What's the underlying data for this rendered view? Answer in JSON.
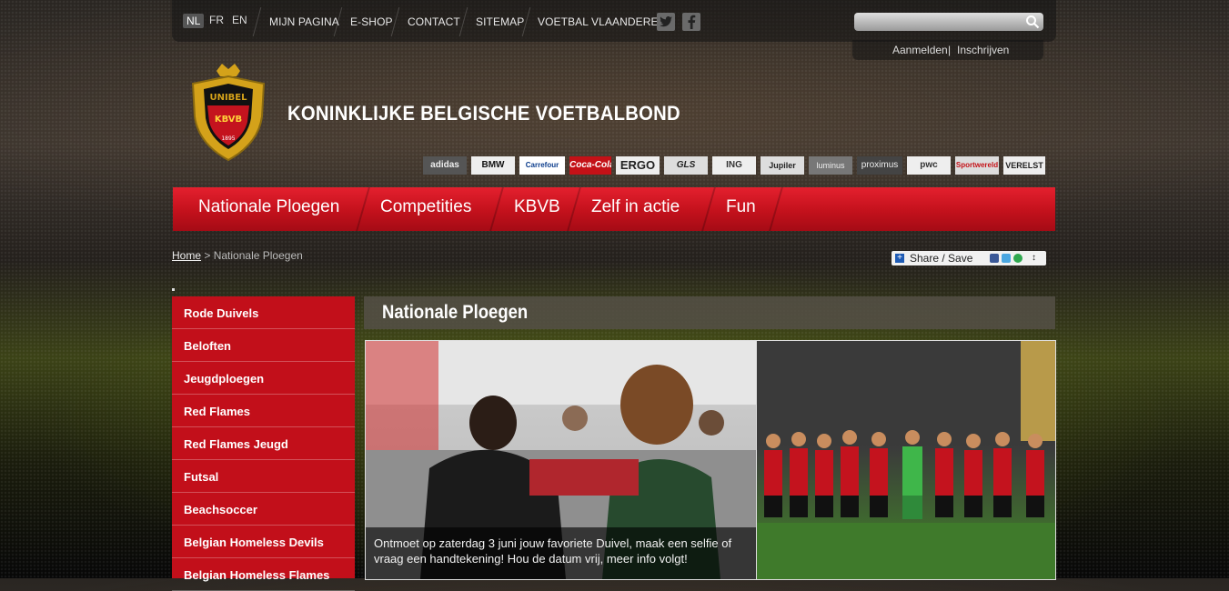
{
  "topbar": {
    "languages": [
      "NL",
      "FR",
      "EN"
    ],
    "links": [
      "MIJN PAGINA",
      "E-SHOP",
      "CONTACT",
      "SITEMAP",
      "VOETBAL VLAANDEREN"
    ],
    "social": [
      "twitter-icon",
      "facebook-icon"
    ],
    "search": {
      "placeholder": ""
    },
    "login": "Aanmelden",
    "login_sep": "|",
    "register": "Inschrijven"
  },
  "header": {
    "title": "KONINKLIJKE BELGISCHE VOETBALBOND",
    "crest_text": [
      "UNIBEL",
      "KBVB",
      "1895"
    ]
  },
  "sponsors": [
    "adidas",
    "BMW",
    "Carrefour",
    "Coca-Cola",
    "ERGO",
    "GLS",
    "ING",
    "Jupiler",
    "luminus",
    "proximus",
    "pwc",
    "Sportwereld",
    "VERELST"
  ],
  "nav": [
    "Nationale Ploegen",
    "Competities",
    "KBVB",
    "Zelf in actie",
    "Fun"
  ],
  "breadcrumb": {
    "home": "Home",
    "separator": ">",
    "current": "Nationale Ploegen"
  },
  "share": {
    "label": "Share / Save"
  },
  "sidebar": [
    "Rode Duivels",
    "Beloften",
    "Jeugdploegen",
    "Red Flames",
    "Red Flames Jeugd",
    "Futsal",
    "Beachsoccer",
    "Belgian Homeless Devils",
    "Belgian Homeless Flames"
  ],
  "content": {
    "title": "Nationale Ploegen",
    "caption": "Ontmoet op zaterdag 3 juni jouw favoriete Duivel, maak een selfie of vraag een handtekening! Hou de datum vrij, meer info volgt!"
  },
  "colors": {
    "red": "#c20f1a",
    "nav_red": "#d8131f"
  }
}
